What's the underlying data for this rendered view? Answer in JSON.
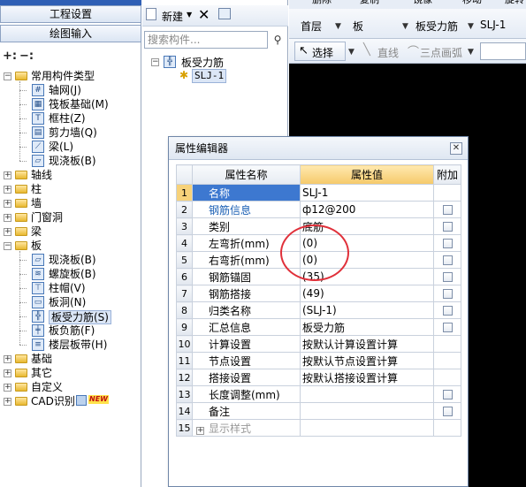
{
  "left": {
    "top_text": "工程设置",
    "btn_project": "工程设置",
    "btn_draw": "绘图输入",
    "tree": [
      {
        "label": "常用构件类型",
        "level": 0,
        "expanded": true
      },
      {
        "label": "轴网(J)",
        "level": 1,
        "icon": "axis-grid-icon"
      },
      {
        "label": "筏板基础(M)",
        "level": 1,
        "icon": "raft-foundation-icon"
      },
      {
        "label": "框柱(Z)",
        "level": 1,
        "icon": "frame-column-icon"
      },
      {
        "label": "剪力墙(Q)",
        "level": 1,
        "icon": "shear-wall-icon"
      },
      {
        "label": "梁(L)",
        "level": 1,
        "icon": "beam-icon"
      },
      {
        "label": "现浇板(B)",
        "level": 1,
        "icon": "cast-slab-icon"
      },
      {
        "label": "轴线",
        "level": 0
      },
      {
        "label": "柱",
        "level": 0
      },
      {
        "label": "墙",
        "level": 0
      },
      {
        "label": "门窗洞",
        "level": 0
      },
      {
        "label": "梁",
        "level": 0
      },
      {
        "label": "板",
        "level": 0,
        "expanded": true
      },
      {
        "label": "现浇板(B)",
        "level": 1,
        "icon": "cast-slab-icon"
      },
      {
        "label": "螺旋板(B)",
        "level": 1,
        "icon": "spiral-slab-icon"
      },
      {
        "label": "柱帽(V)",
        "level": 1,
        "icon": "column-cap-icon"
      },
      {
        "label": "板洞(N)",
        "level": 1,
        "icon": "slab-hole-icon"
      },
      {
        "label": "板受力筋(S)",
        "level": 1,
        "icon": "slab-rebar-icon",
        "selected": true
      },
      {
        "label": "板负筋(F)",
        "level": 1,
        "icon": "negative-rebar-icon"
      },
      {
        "label": "楼层板带(H)",
        "level": 1,
        "icon": "floor-strip-icon"
      },
      {
        "label": "基础",
        "level": 0
      },
      {
        "label": "其它",
        "level": 0
      },
      {
        "label": "自定义",
        "level": 0
      },
      {
        "label": "CAD识别",
        "level": 0,
        "badge": "NEW"
      }
    ]
  },
  "mid": {
    "new_label": "新建",
    "search_placeholder": "搜索构件...",
    "tree_root": "板受力筋",
    "tree_child": "SLJ-1"
  },
  "right": {
    "top_items": [
      "删除",
      "复制",
      "镜像",
      "移动",
      "旋转"
    ],
    "floor": "首层",
    "category": "板",
    "type": "板受力筋",
    "component": "SLJ-1",
    "select_label": "选择",
    "line_label": "直线",
    "arc_label": "三点画弧"
  },
  "dialog": {
    "title": "属性编辑器",
    "headers": {
      "name": "属性名称",
      "value": "属性值",
      "extra": "附加"
    },
    "rows": [
      {
        "idx": "1",
        "name": "名称",
        "value": "SLJ-1",
        "blue": true,
        "check": false
      },
      {
        "idx": "2",
        "name": "钢筋信息",
        "value": "ф12@200",
        "blue": true,
        "check": true
      },
      {
        "idx": "3",
        "name": "类别",
        "value": "底筋",
        "blue": false,
        "check": true
      },
      {
        "idx": "4",
        "name": "左弯折(mm)",
        "value": "(0)",
        "blue": false,
        "check": true
      },
      {
        "idx": "5",
        "name": "右弯折(mm)",
        "value": "(0)",
        "blue": false,
        "check": true
      },
      {
        "idx": "6",
        "name": "钢筋锚固",
        "value": "(35)",
        "blue": false,
        "check": true
      },
      {
        "idx": "7",
        "name": "钢筋搭接",
        "value": "(49)",
        "blue": false,
        "check": true
      },
      {
        "idx": "8",
        "name": "归类名称",
        "value": "(SLJ-1)",
        "blue": false,
        "check": true
      },
      {
        "idx": "9",
        "name": "汇总信息",
        "value": "板受力筋",
        "blue": false,
        "check": true
      },
      {
        "idx": "10",
        "name": "计算设置",
        "value": "按默认计算设置计算",
        "blue": false,
        "check": false
      },
      {
        "idx": "11",
        "name": "节点设置",
        "value": "按默认节点设置计算",
        "blue": false,
        "check": false
      },
      {
        "idx": "12",
        "name": "搭接设置",
        "value": "按默认搭接设置计算",
        "blue": false,
        "check": false
      },
      {
        "idx": "13",
        "name": "长度调整(mm)",
        "value": "",
        "blue": false,
        "check": true
      },
      {
        "idx": "14",
        "name": "备注",
        "value": "",
        "blue": false,
        "check": true
      },
      {
        "idx": "15",
        "name": "显示样式",
        "value": "",
        "blue": false,
        "check": false,
        "expandable": true
      }
    ]
  },
  "colors": {
    "accent": "#3d78d0",
    "header_value": "#f5c96a",
    "annotation": "#e0303a"
  }
}
